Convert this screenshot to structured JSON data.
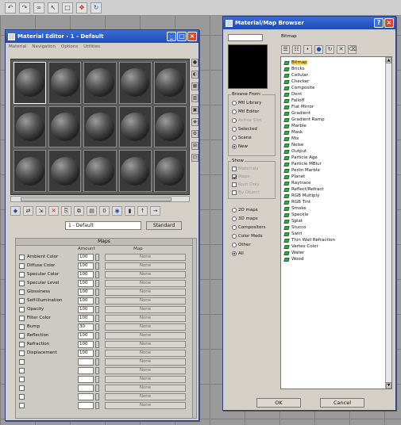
{
  "material_editor": {
    "title": "Material Editor - 1 - Default",
    "menu": [
      "Material",
      "Navigation",
      "Options",
      "Utilities"
    ],
    "material_name": "1 - Default",
    "material_type": "Standard",
    "maps_header": "Maps",
    "col_amount": "Amount",
    "col_map": "Map",
    "map_rows": [
      {
        "label": "Ambient Color",
        "amount": "100",
        "map": "None"
      },
      {
        "label": "Diffuse Color",
        "amount": "100",
        "map": "None"
      },
      {
        "label": "Specular Color",
        "amount": "100",
        "map": "None"
      },
      {
        "label": "Specular Level",
        "amount": "100",
        "map": "None"
      },
      {
        "label": "Glossiness",
        "amount": "100",
        "map": "None"
      },
      {
        "label": "Self-Illumination",
        "amount": "100",
        "map": "None"
      },
      {
        "label": "Opacity",
        "amount": "100",
        "map": "None"
      },
      {
        "label": "Filter Color",
        "amount": "100",
        "map": "None"
      },
      {
        "label": "Bump",
        "amount": "30",
        "map": "None"
      },
      {
        "label": "Reflection",
        "amount": "100",
        "map": "None"
      },
      {
        "label": "Refraction",
        "amount": "100",
        "map": "None"
      },
      {
        "label": "Displacement",
        "amount": "100",
        "map": "None"
      },
      {
        "label": "",
        "amount": "",
        "map": "None"
      },
      {
        "label": "",
        "amount": "",
        "map": "None"
      },
      {
        "label": "",
        "amount": "",
        "map": "None"
      },
      {
        "label": "",
        "amount": "",
        "map": "None"
      },
      {
        "label": "",
        "amount": "",
        "map": "None"
      },
      {
        "label": "",
        "amount": "",
        "map": "None"
      }
    ]
  },
  "map_browser": {
    "title": "Material/Map Browser",
    "header_label": "Bitmap",
    "browse_from": {
      "title": "Browse From:",
      "options": [
        "Mtl Library",
        "Mtl Editor",
        "Active Slot",
        "Selected",
        "Scene",
        "New"
      ],
      "selected_index": 5
    },
    "show": {
      "title": "Show",
      "options": [
        "Materials",
        "Maps",
        "Root Only",
        "By Object"
      ]
    },
    "categories": {
      "options": [
        "2D maps",
        "3D maps",
        "Compositors",
        "Color Mods",
        "Other",
        "All"
      ],
      "selected_index": 5
    },
    "items": [
      "Bitmap",
      "Bricks",
      "Cellular",
      "Checker",
      "Composite",
      "Dent",
      "Falloff",
      "Flat Mirror",
      "Gradient",
      "Gradient Ramp",
      "Marble",
      "Mask",
      "Mix",
      "Noise",
      "Output",
      "Particle Age",
      "Particle MBlur",
      "Perlin Marble",
      "Planet",
      "Raytrace",
      "Reflect/Refract",
      "RGB Multiply",
      "RGB Tint",
      "Smoke",
      "Speckle",
      "Splat",
      "Stucco",
      "Swirl",
      "Thin Wall Refraction",
      "Vertex Color",
      "Water",
      "Wood"
    ],
    "selected_item": "Bitmap",
    "ok_label": "OK",
    "cancel_label": "Cancel"
  }
}
